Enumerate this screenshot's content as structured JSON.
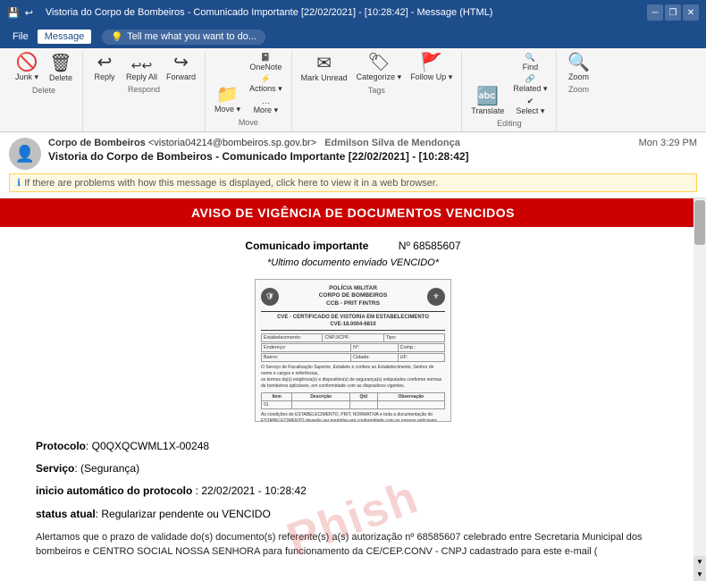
{
  "titleBar": {
    "title": "Vistoria do Corpo de Bombeiros - Comunicado Importante [22/02/2021] - [10:28:42] - Message (HTML)",
    "controls": [
      "minimize",
      "restore",
      "close"
    ]
  },
  "menuBar": {
    "items": [
      "File",
      "Message"
    ],
    "activeItem": "Message",
    "tellMe": "Tell me what you want to do..."
  },
  "ribbon": {
    "groups": [
      {
        "label": "Delete",
        "buttons": [
          {
            "icon": "🚫",
            "label": "Junk"
          },
          {
            "icon": "🗑",
            "label": "Delete"
          }
        ]
      },
      {
        "label": "Respond",
        "buttons": [
          {
            "icon": "↩",
            "label": "Reply"
          },
          {
            "icon": "↩↩",
            "label": "Reply All"
          },
          {
            "icon": "→",
            "label": "Forward"
          }
        ]
      },
      {
        "label": "Move",
        "buttons": [
          {
            "icon": "📁",
            "label": "Move"
          },
          {
            "icon": "📓",
            "label": "OneNote"
          },
          {
            "icon": "⚡",
            "label": "Actions"
          },
          {
            "icon": "➕",
            "label": "More"
          }
        ]
      },
      {
        "label": "Tags",
        "buttons": [
          {
            "icon": "✉",
            "label": "Mark Unread"
          },
          {
            "icon": "🏷",
            "label": "Categorize"
          },
          {
            "icon": "🚩",
            "label": "Follow Up"
          }
        ]
      },
      {
        "label": "Editing",
        "buttons": [
          {
            "icon": "🔤",
            "label": "Translate"
          },
          {
            "icon": "🔍",
            "label": "Find"
          },
          {
            "icon": "🔗",
            "label": "Related"
          },
          {
            "icon": "✔",
            "label": "Select"
          }
        ]
      },
      {
        "label": "Zoom",
        "buttons": [
          {
            "icon": "🔍",
            "label": "Zoom"
          }
        ]
      }
    ]
  },
  "email": {
    "from": "Corpo de Bombeiros <vistoria04214@bombeiros.sp.gov.br>",
    "to": "Edmilson Silva de Mendonça",
    "subject": "Vistoria do Corpo de Bombeiros - Comunicado Importante [22/02/2021] - [10:28:42]",
    "date": "Mon 3:29 PM",
    "infoBar": "If there are problems with how this message is displayed, click here to view it in a web browser.",
    "body": {
      "alertHeader": "AVISO DE VIGÊNCIA DE DOCUMENTOS VENCIDOS",
      "noticeLabel": "Comunicado importante",
      "noticeNumber": "Nº 68585607",
      "subtitle": "*Ultimo documento enviado VENCIDO*",
      "docHeader": {
        "line1": "POLÍCIA MILITAR",
        "line2": "CORPO DE BOMBEIROS",
        "line3": "CCB - PRIT FINTRS"
      },
      "docTitle": "CVE - CERTIFICADO DE VISTORIA EM ESTABELECIMENTO",
      "docNumber": "CVE-18.0004-6810",
      "fields": [
        {
          "label": "Estabelecimento",
          "value": ""
        },
        {
          "label": "Endereço",
          "value": ""
        }
      ],
      "infoFields": [
        {
          "label": "Protocolo",
          "value": "Q0QXQCWML1X-00248"
        },
        {
          "label": "Serviço",
          "value": "(Segurança)"
        },
        {
          "label": "inicio automático do protocolo",
          "value": "22/02/2021 - 10:28:42"
        },
        {
          "label": "status atual",
          "value": "Regularizar pendente ou VENCIDO"
        }
      ],
      "bottomText": "Alertamos que o prazo de validade do(s) documento(s) referente(s) a(s) autorização nº 68585607 celebrado entre Secretaria Municipal dos bombeiros e CENTRO SOCIAL NOSSA SENHORA para funcionamento da CE/CEP.CONV - CNPJ cadastrado para este e-mail ("
    }
  },
  "watermark": "Phish"
}
